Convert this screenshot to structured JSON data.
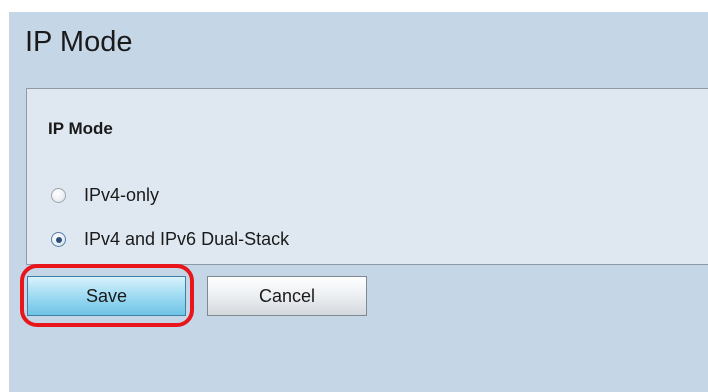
{
  "page": {
    "title": "IP Mode"
  },
  "panel": {
    "title": "IP Mode",
    "options": [
      {
        "label": "IPv4-only",
        "checked": false
      },
      {
        "label": "IPv4 and IPv6 Dual-Stack",
        "checked": true
      }
    ]
  },
  "buttons": {
    "save_label": "Save",
    "cancel_label": "Cancel"
  },
  "annotation": {
    "highlight_color": "#e8161b",
    "highlighted_element": "save-button"
  },
  "colors": {
    "page_background": "#c5d6e7",
    "panel_background": "#dfe8f1",
    "save_button": "#9edbf2"
  }
}
